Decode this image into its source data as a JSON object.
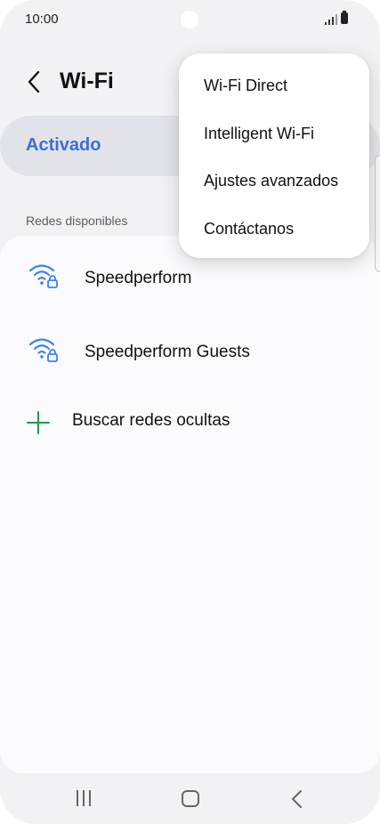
{
  "status_bar": {
    "time": "10:00",
    "icons": [
      "signal-icon",
      "battery-icon"
    ]
  },
  "header": {
    "back_icon": "chevron-left-icon",
    "title": "Wi-Fi"
  },
  "wifi_toggle": {
    "label": "Activado",
    "state": "on",
    "accent_color": "#3a6fd6"
  },
  "networks_section": {
    "label": "Redes disponibles",
    "networks": [
      {
        "name": "Speedperform",
        "icon": "wifi-locked-icon"
      },
      {
        "name": "Speedperform Guests",
        "icon": "wifi-locked-icon"
      }
    ],
    "add_hidden": {
      "label": "Buscar redes ocultas",
      "icon": "plus-icon",
      "icon_color": "#1c9c4a"
    }
  },
  "overflow_menu": {
    "items": [
      {
        "label": "Wi-Fi Direct"
      },
      {
        "label": "Intelligent Wi-Fi"
      },
      {
        "label": "Ajustes avanzados"
      },
      {
        "label": "Contáctanos"
      }
    ]
  },
  "nav_bar": {
    "icons": [
      "recents-icon",
      "home-icon",
      "back-icon"
    ]
  },
  "colors": {
    "wifi_icon": "#3e80f4",
    "background": "#f2f2f4",
    "list_background": "#fbfbfd"
  }
}
